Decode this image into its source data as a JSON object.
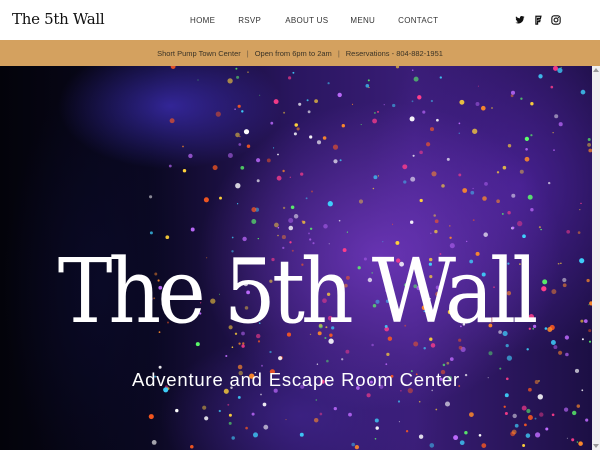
{
  "header": {
    "logo": "The 5th Wall",
    "nav": [
      "HOME",
      "RSVP",
      "ABOUT US",
      "MENU",
      "CONTACT"
    ],
    "social": [
      "twitter-icon",
      "foursquare-icon",
      "instagram-icon"
    ]
  },
  "infobar": {
    "location": "Short Pump Town Center",
    "hours": "Open from 6pm to 2am",
    "reservations": "Reservations - 804-882-1951",
    "separator": "|",
    "background_color": "#d4a15f"
  },
  "hero": {
    "title": "The 5th Wall",
    "subtitle": "Adventure and Escape Room Center"
  }
}
